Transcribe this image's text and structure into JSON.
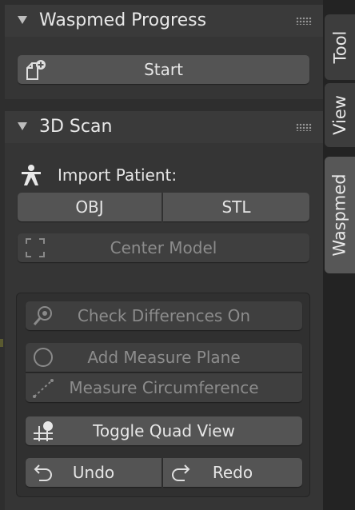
{
  "panels": {
    "progress": {
      "title": "Waspmed Progress",
      "start_label": "Start"
    },
    "scan": {
      "title": "3D Scan",
      "import_label": "Import Patient:",
      "obj_label": "OBJ",
      "stl_label": "STL",
      "center_label": "Center Model",
      "check_label": "Check Differences On",
      "add_plane_label": "Add Measure Plane",
      "measure_label": "Measure Circumference",
      "quad_label": "Toggle Quad View",
      "undo_label": "Undo",
      "redo_label": "Redo"
    }
  },
  "tabs": {
    "tool": "Tool",
    "view": "View",
    "waspmed": "Waspmed"
  },
  "icons": {
    "start": "new-file-icon",
    "import": "person-icon",
    "center": "frame-corners-icon",
    "check": "magnifier-icon",
    "plane": "circle-icon",
    "measure": "dashed-line-icon",
    "quad": "grid-icon",
    "undo": "undo-arrow-icon",
    "redo": "redo-arrow-icon"
  },
  "colors": {
    "button": "#545454",
    "button_disabled": "#3f3f3f",
    "header": "#3a3a3a",
    "active_tab": "#575757"
  }
}
